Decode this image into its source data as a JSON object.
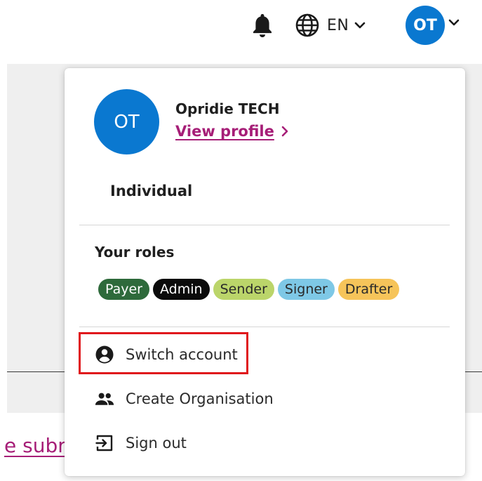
{
  "header": {
    "language": "EN",
    "user_initials": "OT"
  },
  "background": {
    "link_fragment": "e subr"
  },
  "menu": {
    "avatar_initials": "OT",
    "user_name": "Opridie TECH",
    "view_profile": "View profile",
    "account_type": "Individual",
    "roles_title": "Your roles",
    "roles": [
      {
        "label": "Payer",
        "bg": "#2e6a3b",
        "fg": "#ffffff"
      },
      {
        "label": "Admin",
        "bg": "#0b0b0b",
        "fg": "#ffffff"
      },
      {
        "label": "Sender",
        "bg": "#bbd56a",
        "fg": "#2a2a2a"
      },
      {
        "label": "Signer",
        "bg": "#7ec8e6",
        "fg": "#2a2a2a"
      },
      {
        "label": "Drafter",
        "bg": "#f6c45a",
        "fg": "#2a2a2a"
      }
    ],
    "items": [
      {
        "label": "Switch account",
        "icon": "account-circle-icon"
      },
      {
        "label": "Create Organisation",
        "icon": "people-icon"
      },
      {
        "label": "Sign out",
        "icon": "sign-out-icon"
      }
    ]
  },
  "colors": {
    "brand_blue": "#0a78d0",
    "link_magenta": "#a61e77",
    "highlight_red": "#e0181c"
  }
}
